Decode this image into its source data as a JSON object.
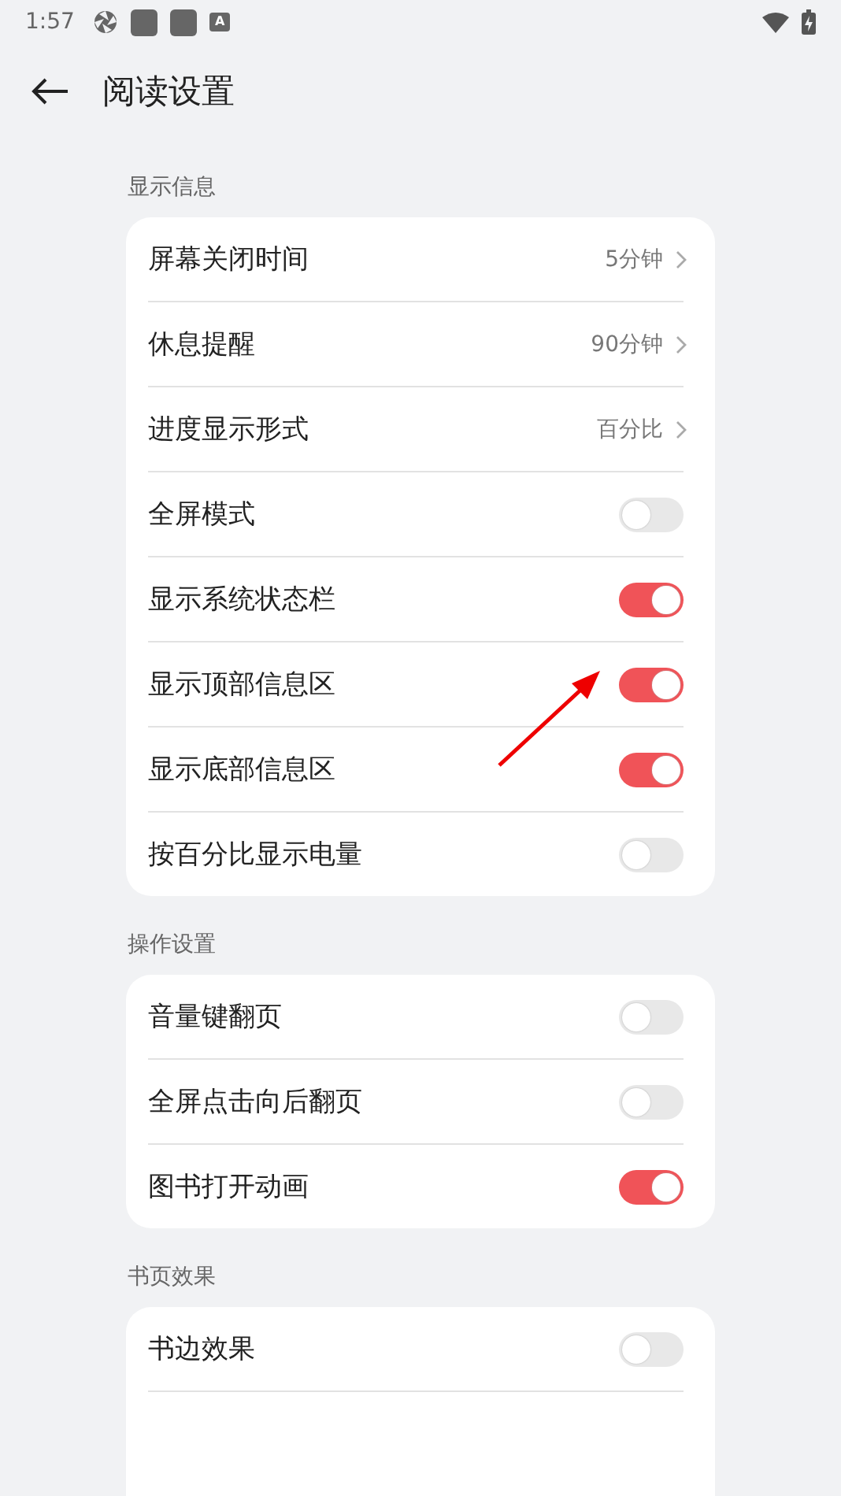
{
  "status_bar": {
    "time": "1:57",
    "badge": "A"
  },
  "header": {
    "title": "阅读设置"
  },
  "sections": [
    {
      "title": "显示信息",
      "items": [
        {
          "label": "屏幕关闭时间",
          "kind": "link",
          "value": "5分钟"
        },
        {
          "label": "休息提醒",
          "kind": "link",
          "value": "90分钟"
        },
        {
          "label": "进度显示形式",
          "kind": "link",
          "value": "百分比"
        },
        {
          "label": "全屏模式",
          "kind": "toggle",
          "on": false
        },
        {
          "label": "显示系统状态栏",
          "kind": "toggle",
          "on": true
        },
        {
          "label": "显示顶部信息区",
          "kind": "toggle",
          "on": true
        },
        {
          "label": "显示底部信息区",
          "kind": "toggle",
          "on": true
        },
        {
          "label": "按百分比显示电量",
          "kind": "toggle",
          "on": false
        }
      ]
    },
    {
      "title": "操作设置",
      "items": [
        {
          "label": "音量键翻页",
          "kind": "toggle",
          "on": false
        },
        {
          "label": "全屏点击向后翻页",
          "kind": "toggle",
          "on": false
        },
        {
          "label": "图书打开动画",
          "kind": "toggle",
          "on": true
        }
      ]
    },
    {
      "title": "书页效果",
      "items": [
        {
          "label": "书边效果",
          "kind": "toggle",
          "on": false
        },
        {
          "kind": "cut"
        }
      ]
    }
  ]
}
